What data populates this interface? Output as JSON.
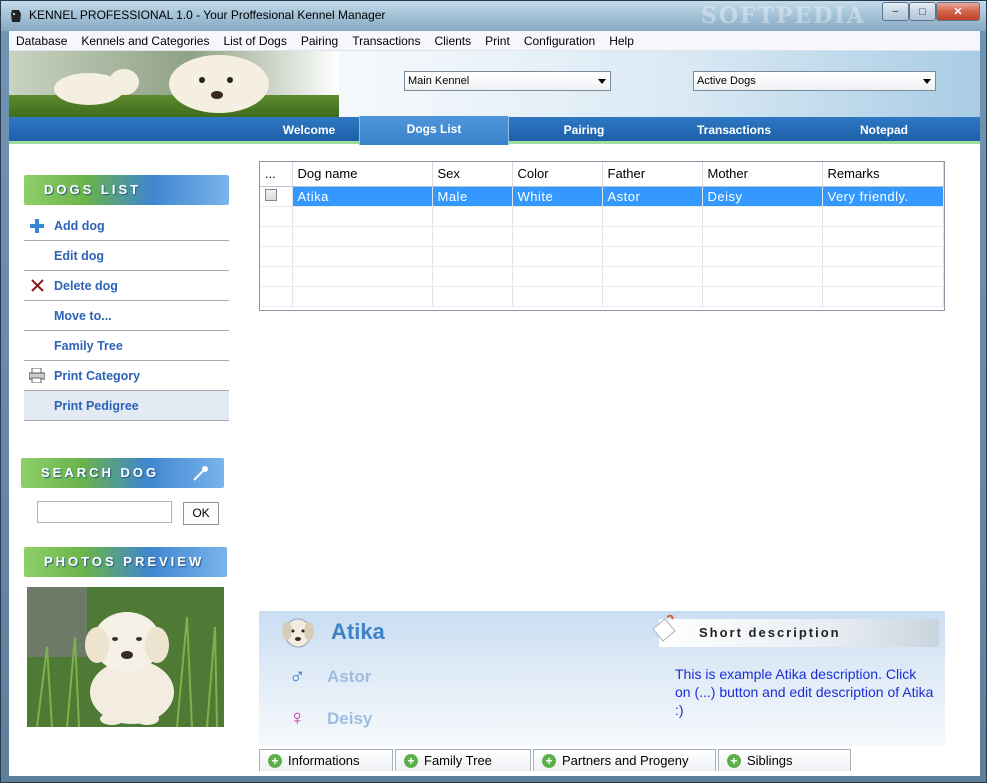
{
  "window": {
    "title": "KENNEL PROFESSIONAL 1.0 - Your Proffesional Kennel Manager",
    "watermark": "SOFTPEDIA",
    "minimize": "−",
    "maximize": "□",
    "close": "✕"
  },
  "menu": [
    "Database",
    "Kennels and Categories",
    "List of Dogs",
    "Pairing",
    "Transactions",
    "Clients",
    "Print",
    "Configuration",
    "Help"
  ],
  "header": {
    "kennel_select": "Main Kennel",
    "status_select": "Active Dogs"
  },
  "tabs": [
    "Welcome",
    "Dogs List",
    "Pairing",
    "Transactions",
    "Notepad"
  ],
  "active_tab": "Dogs List",
  "sidebar": {
    "dogs_list_title": "DOGS LIST",
    "items": [
      {
        "label": "Add dog",
        "icon": "plus-icon"
      },
      {
        "label": "Edit dog",
        "icon": ""
      },
      {
        "label": "Delete dog",
        "icon": "delete-x-icon"
      },
      {
        "label": "Move to...",
        "icon": ""
      },
      {
        "label": "Family Tree",
        "icon": ""
      },
      {
        "label": "Print Category",
        "icon": "printer-icon"
      },
      {
        "label": "Print Pedigree",
        "icon": ""
      }
    ],
    "search_title": "SEARCH DOG",
    "search_value": "",
    "ok_label": "OK",
    "photos_title": "PHOTOS PREVIEW"
  },
  "grid": {
    "columns": [
      "...",
      "Dog name",
      "Sex",
      "Color",
      "Father",
      "Mother",
      "Remarks"
    ],
    "rows": [
      {
        "name": "Atika",
        "sex": "Male",
        "color": "White",
        "father": "Astor",
        "mother": "Deisy",
        "remarks": "Very friendly."
      }
    ]
  },
  "detail": {
    "dog_name": "Atika",
    "father": "Astor",
    "mother": "Deisy",
    "male_symbol": "♂",
    "female_symbol": "♀",
    "desc_title": "Short description",
    "description": "This is example Atika description. Click on (...) button and edit description of Atika :)"
  },
  "bottom_tabs": [
    "Informations",
    "Family Tree",
    "Partners and Progeny",
    "Siblings"
  ],
  "colors": {
    "accent_blue": "#1d5fa8",
    "link_blue": "#2e63b6",
    "selection": "#3399ff",
    "desc_text": "#1a2fd6"
  }
}
